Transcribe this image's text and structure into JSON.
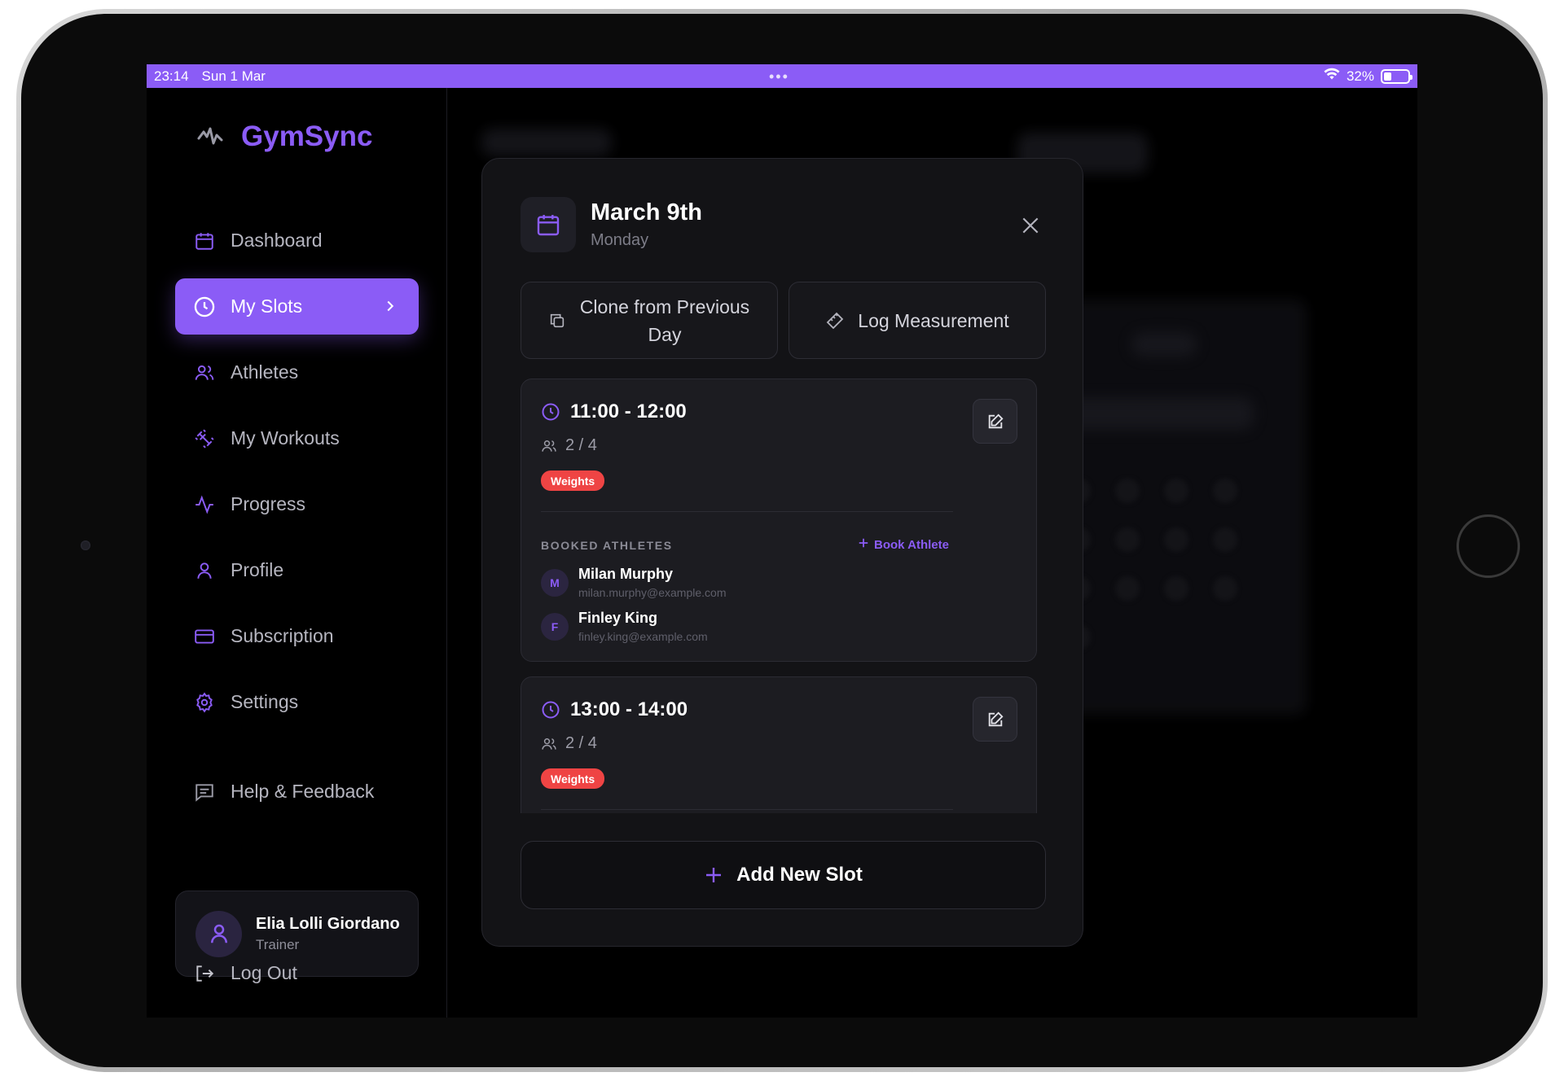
{
  "status_bar": {
    "time": "23:14",
    "date": "Sun 1 Mar",
    "dots": "•••",
    "battery_percent": "32%",
    "battery_level": 0.32
  },
  "sidebar": {
    "brand": "GymSync",
    "items": [
      {
        "label": "Dashboard",
        "icon": "calendar-icon",
        "active": false
      },
      {
        "label": "My Slots",
        "icon": "clock-icon",
        "active": true
      },
      {
        "label": "Athletes",
        "icon": "users-icon",
        "active": false
      },
      {
        "label": "My Workouts",
        "icon": "dumbbell-icon",
        "active": false
      },
      {
        "label": "Progress",
        "icon": "activity-icon",
        "active": false
      },
      {
        "label": "Profile",
        "icon": "user-icon",
        "active": false
      },
      {
        "label": "Subscription",
        "icon": "credit-card-icon",
        "active": false
      },
      {
        "label": "Settings",
        "icon": "gear-icon",
        "active": false
      },
      {
        "label": "Help & Feedback",
        "icon": "message-icon",
        "active": false
      }
    ],
    "user": {
      "name": "Elia Lolli Giordano",
      "role": "Trainer"
    },
    "logout": "Log Out"
  },
  "modal": {
    "title": "March 9th",
    "subtitle": "Monday",
    "clone_button": "Clone from Previous Day",
    "log_button": "Log Measurement",
    "slots": [
      {
        "time": "11:00 - 12:00",
        "capacity": "2 / 4",
        "tag": "Weights",
        "booked_label": "BOOKED ATHLETES",
        "book_link": "Book Athlete",
        "athletes": [
          {
            "initial": "M",
            "name": "Milan Murphy",
            "email": "milan.murphy@example.com"
          },
          {
            "initial": "F",
            "name": "Finley King",
            "email": "finley.king@example.com"
          }
        ]
      },
      {
        "time": "13:00 - 14:00",
        "capacity": "2 / 4",
        "tag": "Weights"
      }
    ],
    "add_button": "Add New Slot"
  },
  "colors": {
    "accent": "#8b5cf6",
    "tag_red": "#ef4444",
    "background": "#000000",
    "card": "#1c1c21"
  }
}
